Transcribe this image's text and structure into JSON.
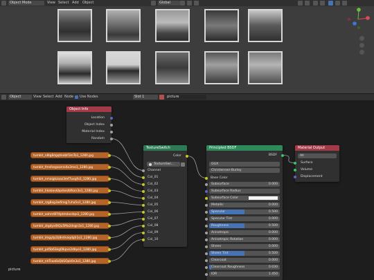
{
  "viewport_header": {
    "mode": "Object Mode",
    "menus": [
      "View",
      "Select",
      "Add",
      "Object"
    ],
    "transform": "Global"
  },
  "photos": [
    {
      "id": "p1",
      "tone": "#6b6b6b"
    },
    {
      "id": "p2",
      "tone": "#8a8a8a"
    },
    {
      "id": "p3",
      "tone": "#9a9a9a"
    },
    {
      "id": "p4",
      "tone": "#5a5a5a"
    },
    {
      "id": "p5",
      "tone": "#707070"
    },
    {
      "id": "p6",
      "tone": "#c9c9c9"
    },
    {
      "id": "p7",
      "tone": "#8f8f8f"
    },
    {
      "id": "p8",
      "tone": "#555555"
    },
    {
      "id": "p9",
      "tone": "#7d7d7d"
    },
    {
      "id": "p10",
      "tone": "#a5a5a5"
    }
  ],
  "node_header": {
    "editor": "Object",
    "menus": [
      "View",
      "Select",
      "Add",
      "Node"
    ],
    "use_nodes": "Use Nodes",
    "slot": "Slot 1",
    "material": "picture"
  },
  "object_info": {
    "title": "Object Info",
    "outputs": [
      "Location",
      "Object Index",
      "Material Index",
      "Random"
    ]
  },
  "texture_switch": {
    "title": "TextureSwitch",
    "color_label": "Color",
    "dropdown": "TextureSwi...",
    "channel": "Channel",
    "inputs": [
      "Col_01",
      "Col_02",
      "Col_03",
      "Col_04",
      "Col_05",
      "Col_06",
      "Col_07",
      "Col_08",
      "Col_09",
      "Col_10"
    ]
  },
  "textures": [
    "tumblr_n8lg8dgqhkeblf3mTo1_1280.jpg",
    "tumblr_fmsfzsgazzrxi4a3mo1_1280.jpg",
    "tumblr_nmaigkzaaz3mf7uxgfo1_1280.jpg",
    "tumblr_hkabavkbpdsezbfkan3o1_1280.jpg",
    "tumblr_rzg8og3wfimqj7uha5o1_1280.jpg",
    "tumblr_oohm6Ff4ptmdxcdqo1_1280.jpg",
    "tumblr_ztgdyx0tQu5Ma2dsgn3o1_1280.jpg",
    "tumblr_lmgytp2Ij8ntlvaqdgh1o1_1280.jpg",
    "tumblr_pd5b63eg0lkpvs2dbyo1_1280.jpg",
    "tumblr_nhTsaa6sQbSOpk0n3o1_1280.jpg"
  ],
  "principled": {
    "title": "Principled BSDF",
    "bsdf_label": "BSDF",
    "distribution": "GGX",
    "subsurface_method": "Christensen-Burley",
    "base_color": "Base Color",
    "rows": [
      {
        "label": "Subsurface",
        "value": "0.000",
        "bar": 0
      },
      {
        "label": "Subsurface Radius",
        "value": "",
        "bar": 0
      },
      {
        "label": "Subsurface Color",
        "value": "",
        "bar": 0
      },
      {
        "label": "Metallic",
        "value": "0.000",
        "bar": 0
      },
      {
        "label": "Specular",
        "value": "0.500",
        "bar": 0.5
      },
      {
        "label": "Specular Tint",
        "value": "0.000",
        "bar": 0
      },
      {
        "label": "Roughness",
        "value": "0.500",
        "bar": 0.5
      },
      {
        "label": "Anisotropic",
        "value": "0.000",
        "bar": 0
      },
      {
        "label": "Anisotropic Rotation",
        "value": "0.000",
        "bar": 0
      },
      {
        "label": "Sheen",
        "value": "0.000",
        "bar": 0
      },
      {
        "label": "Sheen Tint",
        "value": "0.500",
        "bar": 0.5
      },
      {
        "label": "Clearcoat",
        "value": "0.000",
        "bar": 0
      },
      {
        "label": "Clearcoat Roughness",
        "value": "0.030",
        "bar": 0.03
      },
      {
        "label": "IOR",
        "value": "1.450",
        "bar": 0
      }
    ]
  },
  "material_output": {
    "title": "Material Output",
    "target": "All",
    "inputs": [
      "Surface",
      "Volume",
      "Displacement"
    ]
  },
  "footer_label": "picture",
  "colors": {
    "object_info_header": "#a23a48",
    "texture_switch_header": "#2e7a55",
    "principled_header": "#2e8a5a",
    "material_output_header": "#a23a48",
    "texture_node": "#b5652a",
    "socket_color": "#c7c729",
    "socket_float": "#a1a1a1",
    "socket_shader": "#38c26a",
    "socket_vector": "#6363c7",
    "wire": "#a0a0a0"
  }
}
